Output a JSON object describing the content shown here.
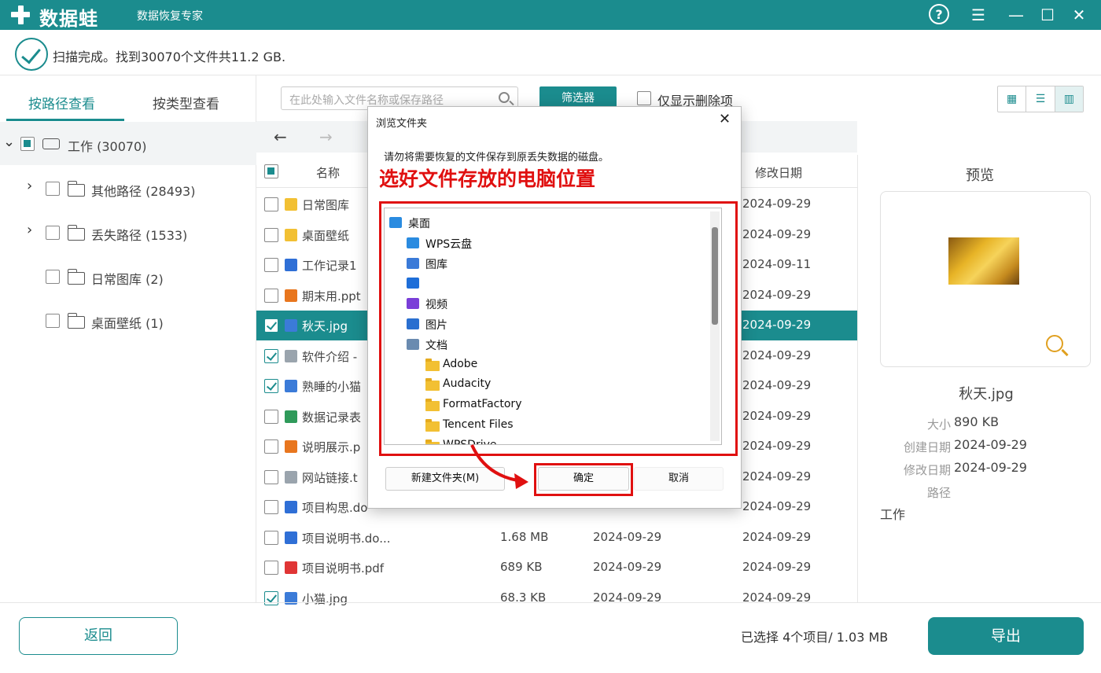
{
  "app": {
    "title": "数据蛙",
    "subtitle": "数据恢复专家",
    "accent_color": "#1b8c8e",
    "window_controls": [
      "help-icon",
      "menu-icon",
      "minimize-icon",
      "maximize-icon",
      "close-icon"
    ]
  },
  "status": {
    "text": "扫描完成。找到30070个文件共11.2 GB."
  },
  "sidebar": {
    "tabs": [
      {
        "label": "按路径查看",
        "active": true
      },
      {
        "label": "按类型查看",
        "active": false
      }
    ],
    "root": {
      "label": "工作 (30070)"
    },
    "items": [
      {
        "label": "其他路径 (28493)",
        "expandable": true
      },
      {
        "label": "丢失路径 (1533)",
        "expandable": true
      },
      {
        "label": "日常图库 (2)",
        "expandable": false
      },
      {
        "label": "桌面壁纸 (1)",
        "expandable": false
      }
    ]
  },
  "toolbar": {
    "search_placeholder": "在此处输入文件名称或保存路径",
    "filter_label": "筛选器",
    "only_deleted_label": "仅显示删除项"
  },
  "table": {
    "columns": {
      "name": "名称",
      "modified": "修改日期"
    },
    "rows": [
      {
        "name": "日常图库",
        "size": "",
        "created": "",
        "modified": "2024-09-29",
        "checked": false,
        "selected": false,
        "icon": "folder-icon"
      },
      {
        "name": "桌面壁纸",
        "size": "",
        "created": "",
        "modified": "2024-09-29",
        "checked": false,
        "selected": false,
        "icon": "folder-icon"
      },
      {
        "name": "工作记录1",
        "size": "",
        "created": "",
        "modified": "2024-09-11",
        "checked": false,
        "selected": false,
        "icon": "word-icon"
      },
      {
        "name": "期末用.ppt",
        "size": "",
        "created": "",
        "modified": "2024-09-29",
        "checked": false,
        "selected": false,
        "icon": "ppt-icon"
      },
      {
        "name": "秋天.jpg",
        "size": "",
        "created": "",
        "modified": "2024-09-29",
        "checked": true,
        "selected": true,
        "icon": "image-icon"
      },
      {
        "name": "软件介绍 -",
        "size": "",
        "created": "",
        "modified": "2024-09-29",
        "checked": true,
        "selected": false,
        "icon": "text-icon"
      },
      {
        "name": "熟睡的小猫",
        "size": "",
        "created": "",
        "modified": "2024-09-29",
        "checked": true,
        "selected": false,
        "icon": "image-icon"
      },
      {
        "name": "数据记录表",
        "size": "",
        "created": "",
        "modified": "2024-09-29",
        "checked": false,
        "selected": false,
        "icon": "excel-icon"
      },
      {
        "name": "说明展示.p",
        "size": "",
        "created": "",
        "modified": "2024-09-29",
        "checked": false,
        "selected": false,
        "icon": "ppt-icon"
      },
      {
        "name": "网站链接.t",
        "size": "",
        "created": "",
        "modified": "2024-09-29",
        "checked": false,
        "selected": false,
        "icon": "text-icon"
      },
      {
        "name": "项目构思.do",
        "size": "",
        "created": "",
        "modified": "2024-09-29",
        "checked": false,
        "selected": false,
        "icon": "word-icon"
      },
      {
        "name": "项目说明书.do...",
        "size": "1.68 MB",
        "created": "2024-09-29",
        "modified": "2024-09-29",
        "checked": false,
        "selected": false,
        "icon": "word-icon"
      },
      {
        "name": "项目说明书.pdf",
        "size": "689 KB",
        "created": "2024-09-29",
        "modified": "2024-09-29",
        "checked": false,
        "selected": false,
        "icon": "pdf-icon"
      },
      {
        "name": "小猫.jpg",
        "size": "68.3 KB",
        "created": "2024-09-29",
        "modified": "2024-09-29",
        "checked": true,
        "selected": false,
        "icon": "image-icon"
      }
    ]
  },
  "preview": {
    "title": "预览",
    "file_name": "秋天.jpg",
    "size_label": "大小",
    "size_value": "890 KB",
    "created_label": "创建日期",
    "created_value": "2024-09-29",
    "modified_label": "修改日期",
    "modified_value": "2024-09-29",
    "path_label": "路径",
    "path_value": "工作"
  },
  "footer": {
    "back_label": "返回",
    "selection_info": "已选择 4个项目/ 1.03 MB",
    "export_label": "导出"
  },
  "dialog": {
    "title": "浏览文件夹",
    "message": "请勿将需要恢复的文件保存到原丢失数据的磁盘。",
    "annotation": "选好文件存放的电脑位置",
    "tree": [
      {
        "label": "桌面",
        "depth": 0,
        "expander": "",
        "icon": "desktop-icon"
      },
      {
        "label": "WPS云盘",
        "depth": 1,
        "expander": "›",
        "icon": "cloud-icon"
      },
      {
        "label": "图库",
        "depth": 1,
        "expander": "",
        "icon": "gallery-icon"
      },
      {
        "label": "",
        "depth": 1,
        "expander": "›",
        "icon": "onedrive-icon"
      },
      {
        "label": "视频",
        "depth": 1,
        "expander": "›",
        "icon": "video-icon"
      },
      {
        "label": "图片",
        "depth": 1,
        "expander": "›",
        "icon": "pictures-icon"
      },
      {
        "label": "文档",
        "depth": 1,
        "expander": "⌄",
        "icon": "documents-icon"
      },
      {
        "label": "Adobe",
        "depth": 2,
        "expander": "›",
        "icon": "folder-icon"
      },
      {
        "label": "Audacity",
        "depth": 2,
        "expander": "",
        "icon": "folder-icon"
      },
      {
        "label": "FormatFactory",
        "depth": 2,
        "expander": "›",
        "icon": "folder-icon"
      },
      {
        "label": "Tencent Files",
        "depth": 2,
        "expander": "›",
        "icon": "folder-icon"
      },
      {
        "label": "WPSDrive",
        "depth": 2,
        "expander": "",
        "icon": "folder-icon"
      }
    ],
    "new_folder_label": "新建文件夹(M)",
    "ok_label": "确定",
    "cancel_label": "取消"
  }
}
